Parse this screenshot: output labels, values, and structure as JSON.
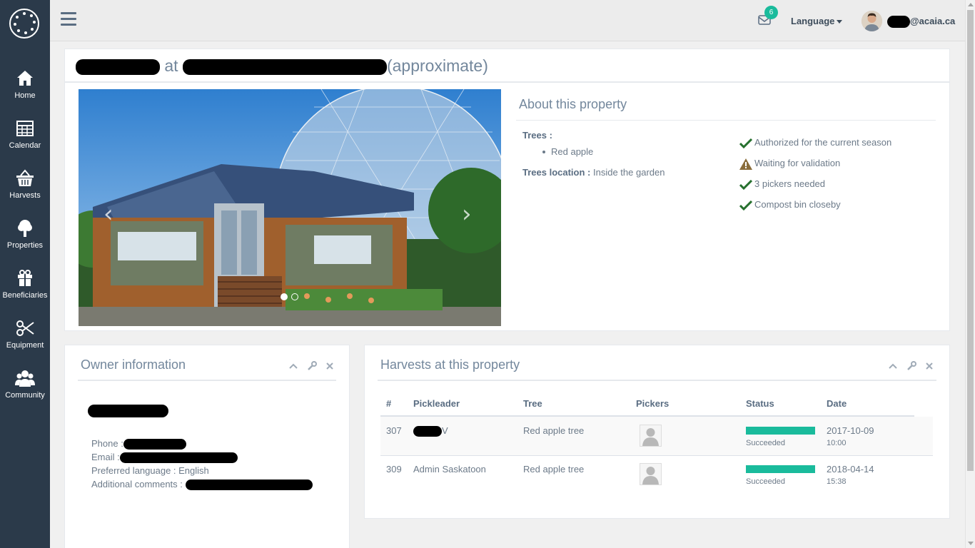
{
  "sidebar": {
    "items": [
      {
        "label": "Home",
        "icon": "home-icon"
      },
      {
        "label": "Calendar",
        "icon": "calendar-icon"
      },
      {
        "label": "Harvests",
        "icon": "basket-icon"
      },
      {
        "label": "Properties",
        "icon": "tree-icon"
      },
      {
        "label": "Beneficiaries",
        "icon": "gift-icon"
      },
      {
        "label": "Equipment",
        "icon": "scissors-icon"
      },
      {
        "label": "Community",
        "icon": "users-icon"
      }
    ]
  },
  "topbar": {
    "mail_count": "6",
    "language_label": "Language",
    "user_email_suffix": "@acaia.ca"
  },
  "property": {
    "title_at": "at",
    "title_suffix": "(approximate)",
    "about_title": "About this property",
    "trees_label": "Trees :",
    "trees": [
      "Red apple"
    ],
    "trees_location_label": "Trees location :",
    "trees_location": "Inside the garden",
    "statuses": [
      {
        "text": "Authorized for the current season",
        "icon": "check-icon"
      },
      {
        "text": "Waiting for validation",
        "icon": "warning-icon"
      },
      {
        "text": "3 pickers needed",
        "icon": "check-icon"
      },
      {
        "text": "Compost bin closeby",
        "icon": "check-icon"
      }
    ]
  },
  "owner": {
    "title": "Owner information",
    "phone_label": "Phone :",
    "email_label": "Email :",
    "preferred_language_line": "Preferred language : English",
    "comments_label": "Additional comments :"
  },
  "harvests": {
    "title": "Harvests at this property",
    "columns": [
      "#",
      "Pickleader",
      "Tree",
      "Pickers",
      "Status",
      "Date"
    ],
    "rows": [
      {
        "id": "307",
        "pickleader": "V",
        "tree": "Red apple tree",
        "status": "Succeeded",
        "progress": 1.0,
        "date": "2017-10-09",
        "time": "10:00"
      },
      {
        "id": "309",
        "pickleader": "Admin Saskatoon",
        "tree": "Red apple tree",
        "status": "Succeeded",
        "progress": 1.0,
        "date": "2018-04-14",
        "time": "15:38"
      }
    ]
  },
  "colors": {
    "sidebar": "#2b3a4a",
    "accent": "#1abb9c",
    "check": "#26702e",
    "warning": "#8a6d3b"
  }
}
